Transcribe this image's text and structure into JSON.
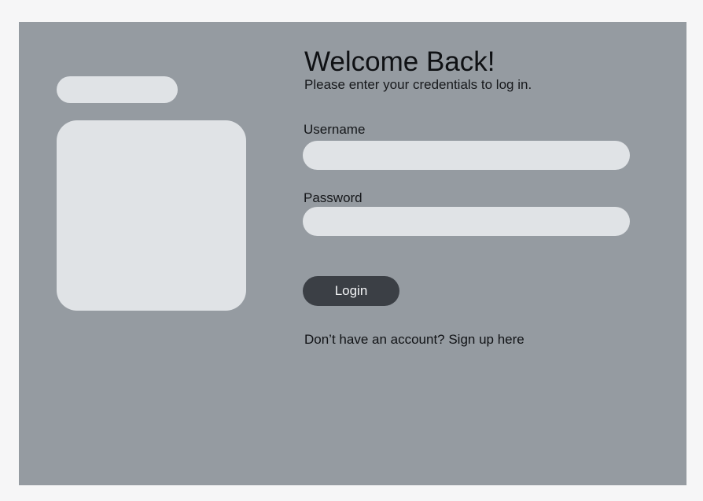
{
  "login": {
    "title": "Welcome Back!",
    "subtitle": "Please enter your credentials to log in.",
    "username_label": "Username",
    "username_value": "",
    "password_label": "Password",
    "password_value": "",
    "login_button": "Login",
    "signup_link": "Don’t have an account? Sign up here"
  },
  "colors": {
    "page_background": "#f6f6f7",
    "panel_background": "#959ba1",
    "placeholder_fill": "#e0e3e6",
    "button_background": "#3b3f45",
    "button_text": "#f2f3f5"
  }
}
